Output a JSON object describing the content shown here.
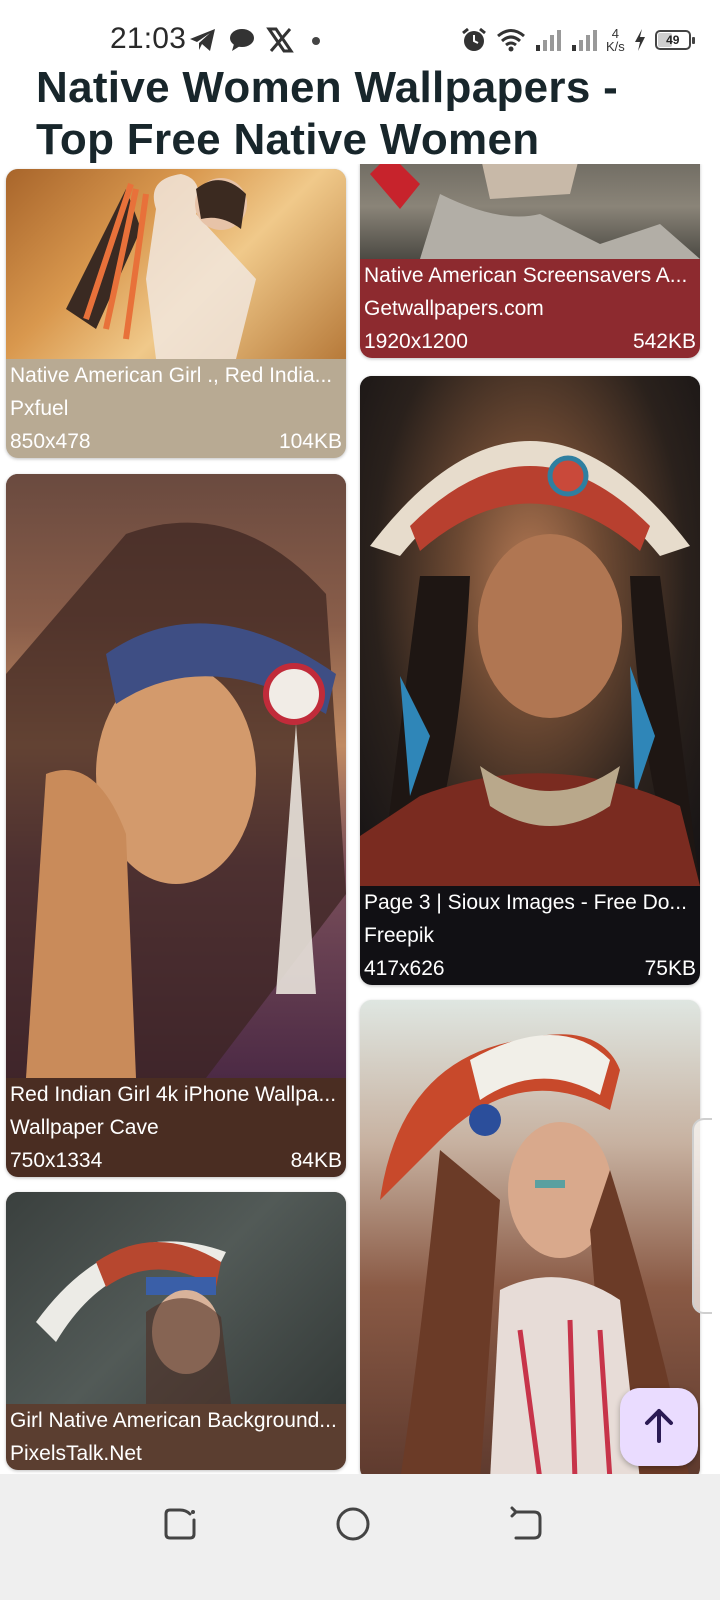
{
  "status_bar": {
    "time": "21:03",
    "left_icons": [
      "telegram-icon",
      "chat-bubble-icon",
      "x-logo-icon",
      "dot-icon"
    ],
    "right_icons": [
      "alarm-icon",
      "wifi-icon",
      "signal-icon",
      "signal-icon"
    ],
    "net_speed_value": "4",
    "net_speed_unit": "K/s",
    "battery_level": "49",
    "charging": true
  },
  "page": {
    "title": "Native Women Wallpapers - Top Free Native Women"
  },
  "cards": [
    {
      "title": "Native American Girl ., Red India...",
      "source": "Pxfuel",
      "dimensions": "850x478",
      "size": "104KB",
      "color": "#b8aa93"
    },
    {
      "title": "Native American Screensavers A...",
      "source": "Getwallpapers.com",
      "dimensions": "1920x1200",
      "size": "542KB",
      "color": "#8d2a2f"
    },
    {
      "title": "Red Indian Girl 4k iPhone Wallpa...",
      "source": "Wallpaper Cave",
      "dimensions": "750x1334",
      "size": "84KB",
      "color": "#4a2d22"
    },
    {
      "title": "Page 3 | Sioux Images - Free Do...",
      "source": "Freepik",
      "dimensions": "417x626",
      "size": "75KB",
      "color": "#111014"
    },
    {
      "title": "Girl Native American Background...",
      "source": "PixelsTalk.Net",
      "dimensions": "",
      "size": "",
      "color": "#5b3e30"
    },
    {
      "title": "",
      "source": "",
      "dimensions": "",
      "size": "",
      "color": "#d9dfd9"
    }
  ],
  "fab": {
    "icon": "arrow-up-icon",
    "color": "#eadcff"
  },
  "nav_bar": {
    "buttons": [
      "recents-icon",
      "home-icon",
      "back-icon"
    ]
  }
}
